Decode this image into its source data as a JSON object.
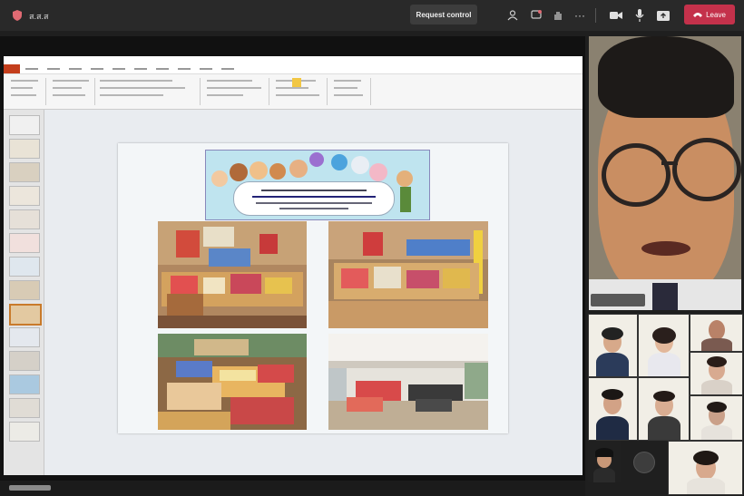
{
  "window": {
    "org_label": "ส.ส.ส",
    "request_control_label": "Request control",
    "leave_label": "Leave"
  },
  "icons": {
    "org": "shield-icon",
    "people": "people-icon",
    "chat": "chat-icon",
    "reactions": "hand-icon",
    "more": "more-icon",
    "camera": "camera-icon",
    "mic": "mic-icon",
    "share": "share-icon",
    "leave": "phone-icon"
  },
  "colors": {
    "leave_button": "#c4314b",
    "topbar": "#292929",
    "powerpoint_accent": "#c43e1c"
  }
}
